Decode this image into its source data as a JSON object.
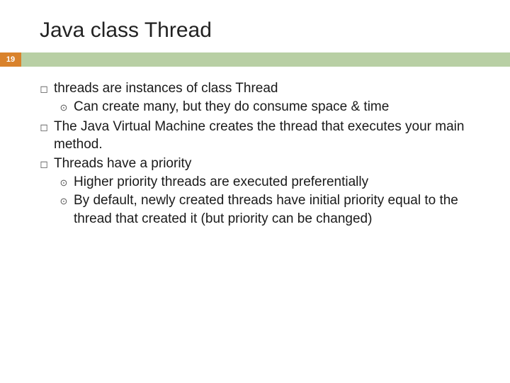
{
  "title": "Java class Thread",
  "slide_number": "19",
  "bullets": [
    {
      "text": "threads are instances of class Thread",
      "sub": [
        "Can create many, but they do consume space & time"
      ]
    },
    {
      "text": "The Java Virtual Machine creates the thread that executes your main method.",
      "sub": []
    },
    {
      "text": "Threads have a priority",
      "sub": [
        "Higher priority threads are executed preferentially",
        "By default, newly created threads have initial priority equal to the thread that created it (but priority can be changed)"
      ]
    }
  ]
}
